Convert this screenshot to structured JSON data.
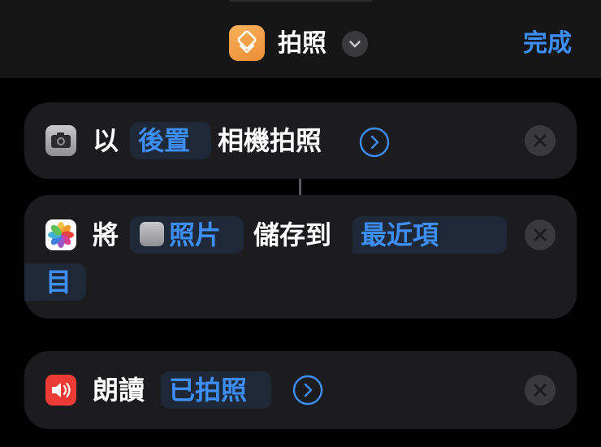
{
  "header": {
    "title": "拍照",
    "done_label": "完成",
    "app_icon": "shortcuts-icon",
    "menu_icon": "chevron-down-icon"
  },
  "actions": [
    {
      "icon": "camera-icon",
      "parts": [
        "以",
        "後置",
        "相機拍照"
      ],
      "token_indexes": [
        1
      ],
      "has_details_arrow": true
    },
    {
      "icon": "photos-icon",
      "parts": [
        "將",
        "照片",
        "儲存到",
        "最近項",
        "目"
      ],
      "token_indexes": [
        1,
        3,
        4
      ],
      "has_details_arrow": false
    },
    {
      "icon": "speaker-icon",
      "parts": [
        "朗讀",
        "已拍照"
      ],
      "token_indexes": [
        1
      ],
      "has_details_arrow": true
    }
  ],
  "colors": {
    "background": "#000000",
    "header": "#161616",
    "card": "#1c1c1e",
    "accent": "#3e8ef7",
    "token_bg": "#1e2836",
    "app_icon": "#f2a04a",
    "speaker_icon": "#ec3b34"
  }
}
